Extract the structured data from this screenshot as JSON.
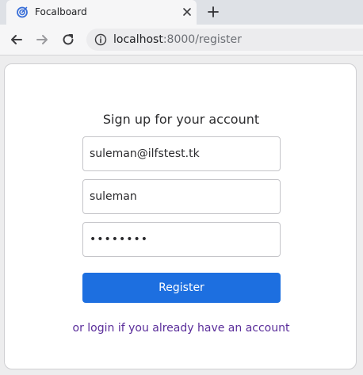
{
  "browser": {
    "tab": {
      "title": "Focalboard",
      "icon": "focalboard-logo-icon",
      "close_icon": "close-icon"
    },
    "new_tab_icon": "plus-icon",
    "nav": {
      "back_icon": "arrow-left-icon",
      "forward_icon": "arrow-right-icon",
      "reload_icon": "reload-icon"
    },
    "address_bar": {
      "info_icon": "info-icon",
      "host": "localhost",
      "rest": ":8000/register"
    }
  },
  "signup": {
    "title": "Sign up for your account",
    "email_value": "suleman@ilfstest.tk",
    "username_value": "suleman",
    "password_value": "••••••••",
    "register_label": "Register",
    "login_link": "or login if you already have an account"
  },
  "colors": {
    "primary_button": "#1d6fe0",
    "link": "#5a2d9a"
  }
}
